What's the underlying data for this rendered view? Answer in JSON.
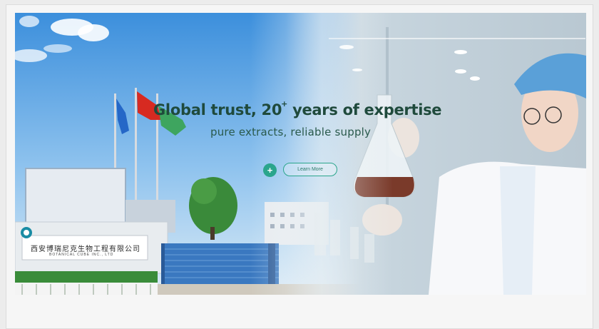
{
  "banner": {
    "headline": "Global trust, 20",
    "headline_sup": "+",
    "headline_rest": " years of expertise",
    "subline": "pure extracts, reliable supply",
    "plus_icon_glyph": "+",
    "more_label": "Learn More",
    "sign_cn": "西安博瑞尼克生物工程有限公司",
    "sign_en": "BOTANICAL CUBE INC., LTD",
    "accent_color": "#2aa58c"
  }
}
